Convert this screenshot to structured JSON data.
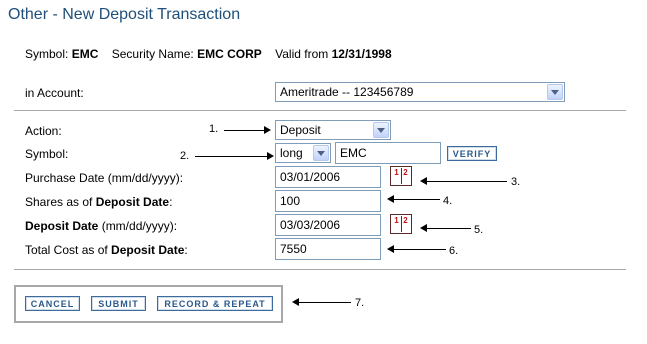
{
  "page": {
    "title": "Other - New Deposit Transaction"
  },
  "security": {
    "symbol_label": "Symbol:",
    "symbol": "EMC",
    "name_label": "Security Name:",
    "name": "EMC CORP",
    "valid_label": "Valid from",
    "valid_date": "12/31/1998"
  },
  "account": {
    "label": "in Account:",
    "value": "Ameritrade -- 123456789"
  },
  "form": {
    "action_label": "Action:",
    "action_value": "Deposit",
    "symbol_label": "Symbol:",
    "position_value": "long",
    "symbol_value": "EMC",
    "verify_label": "VERIFY",
    "purchase_date_label": "Purchase Date (mm/dd/yyyy):",
    "purchase_date_value": "03/01/2006",
    "shares_label_prefix": "Shares as of ",
    "shares_label_bold": "Deposit Date",
    "shares_label_suffix": ":",
    "shares_value": "100",
    "deposit_date_label_bold": "Deposit Date",
    "deposit_date_label_suffix": " (mm/dd/yyyy):",
    "deposit_date_value": "03/03/2006",
    "total_cost_label_prefix": "Total Cost as of ",
    "total_cost_label_bold": "Deposit Date",
    "total_cost_label_suffix": ":",
    "total_cost_value": "7550"
  },
  "buttons": {
    "cancel": "CANCEL",
    "submit": "SUBMIT",
    "record_repeat": "RECORD & REPEAT"
  },
  "calendar_icon": {
    "left_digit": "1",
    "right_digit": "2"
  },
  "annotations": [
    "1.",
    "2.",
    "3.",
    "4.",
    "5.",
    "6.",
    "7."
  ],
  "colors": {
    "title": "#1f4f7a",
    "button_text": "#2a5a8c",
    "field_border": "#7f9db9"
  }
}
